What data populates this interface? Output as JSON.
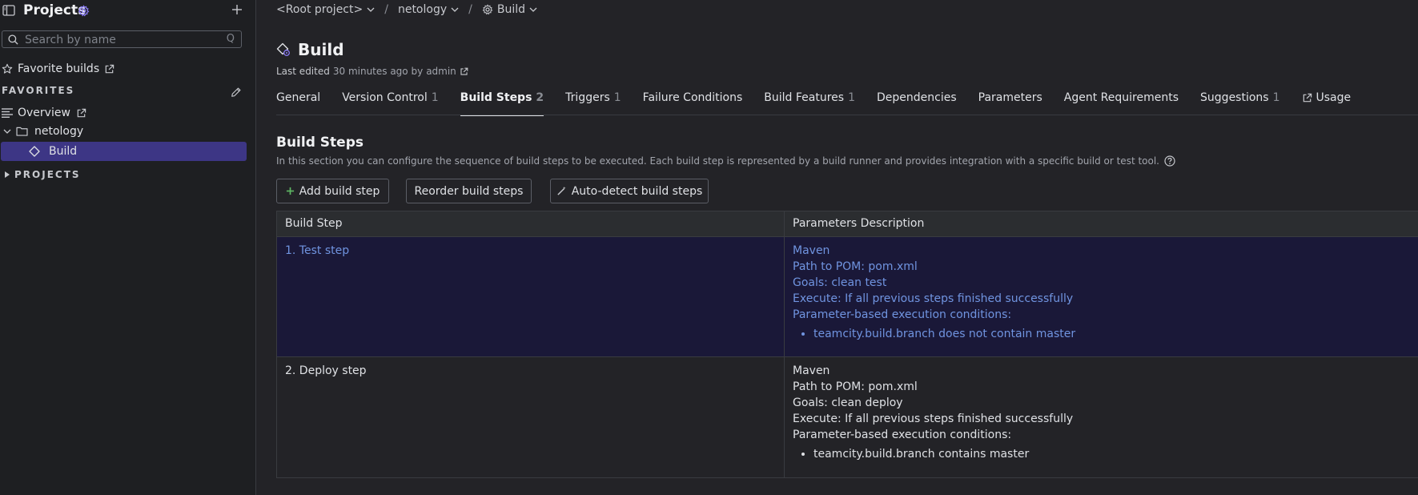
{
  "sidebar": {
    "title": "Projects",
    "search_placeholder": "Search by name",
    "search_shortcut": "Q",
    "favorite_builds": "Favorite builds",
    "favorites_label": "FAVORITES",
    "projects_label": "PROJECTS",
    "items": [
      {
        "label": "Overview"
      },
      {
        "label": "netology"
      },
      {
        "label": "Build"
      }
    ]
  },
  "breadcrumb": {
    "root": "<Root project>",
    "project": "netology",
    "build": "Build",
    "separator": "/"
  },
  "page": {
    "title": "Build",
    "last_edited_label": "Last edited",
    "last_edited_time": "30 minutes ago by",
    "last_edited_user": "admin"
  },
  "tabs": [
    {
      "label": "General",
      "count": ""
    },
    {
      "label": "Version Control",
      "count": "1"
    },
    {
      "label": "Build Steps",
      "count": "2"
    },
    {
      "label": "Triggers",
      "count": "1"
    },
    {
      "label": "Failure Conditions",
      "count": ""
    },
    {
      "label": "Build Features",
      "count": "1"
    },
    {
      "label": "Dependencies",
      "count": ""
    },
    {
      "label": "Parameters",
      "count": ""
    },
    {
      "label": "Agent Requirements",
      "count": ""
    },
    {
      "label": "Suggestions",
      "count": "1"
    },
    {
      "label": "Usage",
      "count": ""
    }
  ],
  "section": {
    "title": "Build Steps",
    "description": "In this section you can configure the sequence of build steps to be executed. Each build step is represented by a build runner and provides integration with a specific build or test tool.",
    "buttons": {
      "add": "Add build step",
      "reorder": "Reorder build steps",
      "autodetect": "Auto-detect build steps"
    }
  },
  "table": {
    "headers": [
      "Build Step",
      "Parameters Description"
    ],
    "rows": [
      {
        "step": "1. Test step",
        "runner": "Maven",
        "pom": "Path to POM: pom.xml",
        "goals": "Goals: clean test",
        "execute": "Execute: If all previous steps finished successfully",
        "conditions_label": "Parameter-based execution conditions:",
        "condition": "teamcity.build.branch does not contain master"
      },
      {
        "step": "2. Deploy step",
        "runner": "Maven",
        "pom": "Path to POM: pom.xml",
        "goals": "Goals: clean deploy",
        "execute": "Execute: If all previous steps finished successfully",
        "conditions_label": "Parameter-based execution conditions:",
        "condition": "teamcity.build.branch contains master"
      }
    ]
  },
  "colors": {
    "accent": "#3d3685",
    "link": "#7094e0",
    "settings_icon": "#8b7cf6",
    "add_plus": "#5fb865"
  }
}
